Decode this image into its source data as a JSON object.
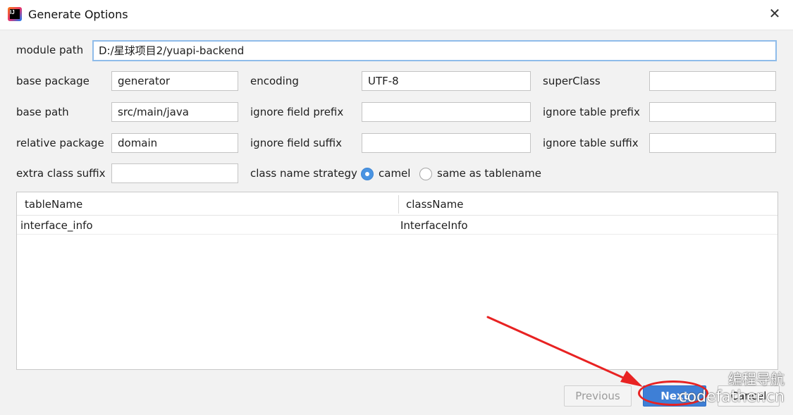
{
  "window": {
    "title": "Generate Options",
    "close_glyph": "✕"
  },
  "form": {
    "module_path": {
      "label": "module path",
      "value": "D:/星球项目2/yuapi-backend"
    },
    "base_package": {
      "label": "base package",
      "value": "generator"
    },
    "encoding": {
      "label": "encoding",
      "value": "UTF-8"
    },
    "super_class": {
      "label": "superClass",
      "value": ""
    },
    "base_path": {
      "label": "base path",
      "value": "src/main/java"
    },
    "ignore_field_prefix": {
      "label": "ignore field prefix",
      "value": ""
    },
    "ignore_table_prefix": {
      "label": "ignore table prefix",
      "value": ""
    },
    "relative_package": {
      "label": "relative package",
      "value": "domain"
    },
    "ignore_field_suffix": {
      "label": "ignore field suffix",
      "value": ""
    },
    "ignore_table_suffix": {
      "label": "ignore table suffix",
      "value": ""
    },
    "extra_class_suffix": {
      "label": "extra class suffix",
      "value": ""
    },
    "class_name_strategy": {
      "label": "class name strategy",
      "options": [
        "camel",
        "same as tablename"
      ],
      "selected": "camel"
    }
  },
  "table": {
    "columns": [
      "tableName",
      "className"
    ],
    "rows": [
      [
        "interface_info",
        "InterfaceInfo"
      ]
    ]
  },
  "buttons": {
    "previous": "Previous",
    "next": "Next",
    "cancel": "Cancel"
  },
  "annotation": {
    "color": "#e82222"
  },
  "watermark": {
    "line1": "编程导航",
    "line2": "codefather.cn"
  }
}
